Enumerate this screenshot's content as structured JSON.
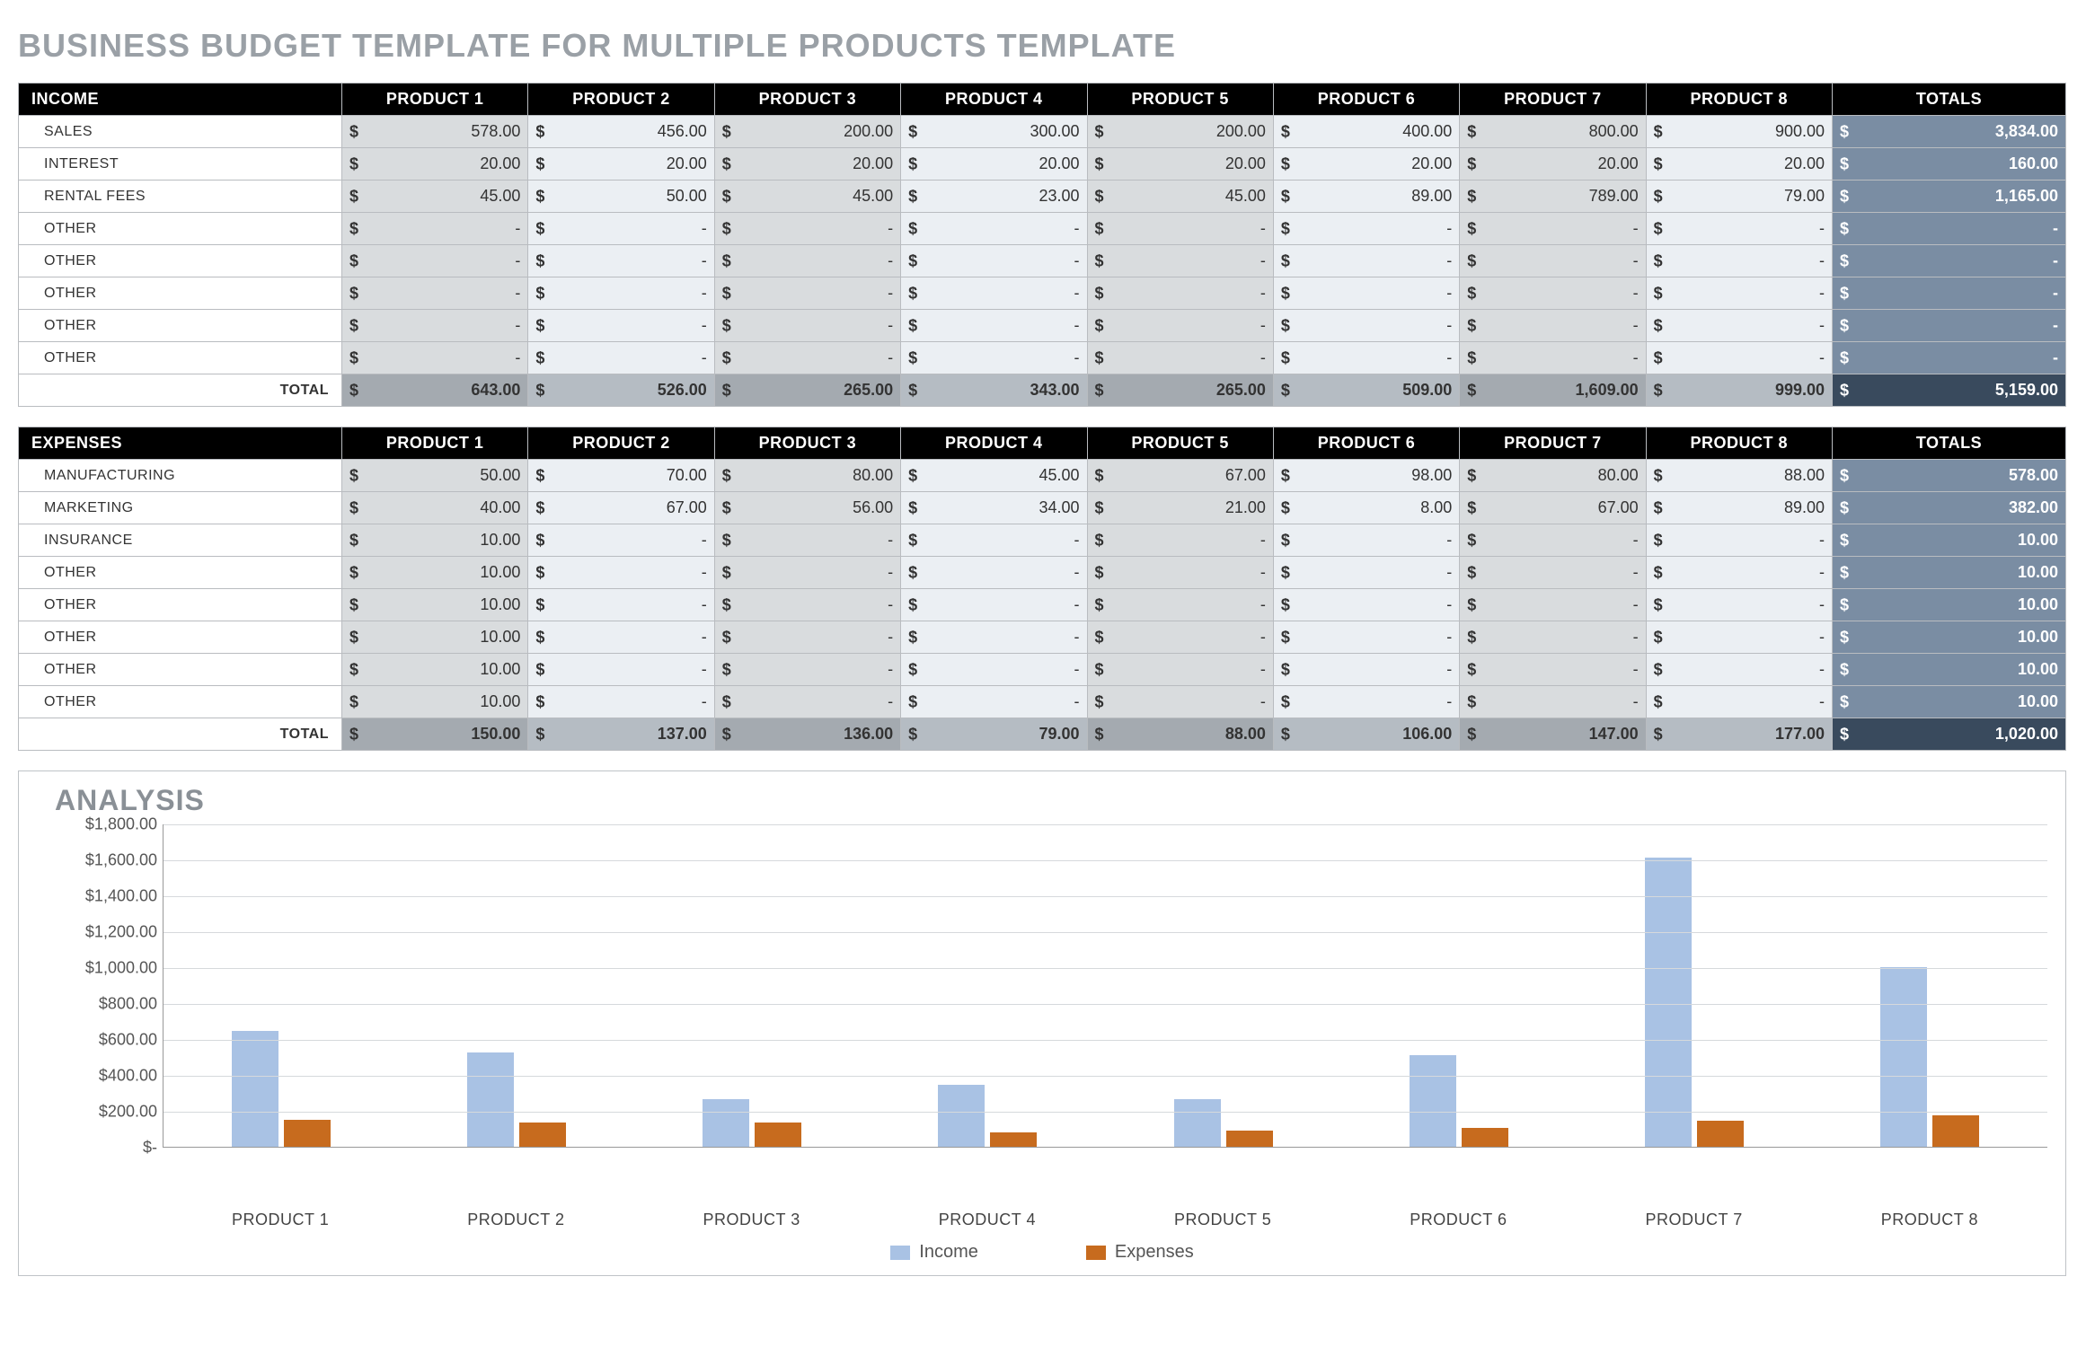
{
  "title": "BUSINESS BUDGET TEMPLATE FOR MULTIPLE PRODUCTS TEMPLATE",
  "currency_symbol": "$",
  "dash": "-",
  "products": [
    "PRODUCT 1",
    "PRODUCT 2",
    "PRODUCT 3",
    "PRODUCT 4",
    "PRODUCT 5",
    "PRODUCT 6",
    "PRODUCT 7",
    "PRODUCT 8"
  ],
  "totals_header": "TOTALS",
  "total_label": "TOTAL",
  "income": {
    "header": "INCOME",
    "rows": [
      {
        "label": "SALES",
        "values": [
          "578.00",
          "456.00",
          "200.00",
          "300.00",
          "200.00",
          "400.00",
          "800.00",
          "900.00"
        ],
        "total": "3,834.00"
      },
      {
        "label": "INTEREST",
        "values": [
          "20.00",
          "20.00",
          "20.00",
          "20.00",
          "20.00",
          "20.00",
          "20.00",
          "20.00"
        ],
        "total": "160.00"
      },
      {
        "label": "RENTAL FEES",
        "values": [
          "45.00",
          "50.00",
          "45.00",
          "23.00",
          "45.00",
          "89.00",
          "789.00",
          "79.00"
        ],
        "total": "1,165.00"
      },
      {
        "label": "OTHER",
        "values": [
          "-",
          "-",
          "-",
          "-",
          "-",
          "-",
          "-",
          "-"
        ],
        "total": "-"
      },
      {
        "label": "OTHER",
        "values": [
          "-",
          "-",
          "-",
          "-",
          "-",
          "-",
          "-",
          "-"
        ],
        "total": "-"
      },
      {
        "label": "OTHER",
        "values": [
          "-",
          "-",
          "-",
          "-",
          "-",
          "-",
          "-",
          "-"
        ],
        "total": "-"
      },
      {
        "label": "OTHER",
        "values": [
          "-",
          "-",
          "-",
          "-",
          "-",
          "-",
          "-",
          "-"
        ],
        "total": "-"
      },
      {
        "label": "OTHER",
        "values": [
          "-",
          "-",
          "-",
          "-",
          "-",
          "-",
          "-",
          "-"
        ],
        "total": "-"
      }
    ],
    "totals_row": {
      "values": [
        "643.00",
        "526.00",
        "265.00",
        "343.00",
        "265.00",
        "509.00",
        "1,609.00",
        "999.00"
      ],
      "total": "5,159.00"
    }
  },
  "expenses": {
    "header": "EXPENSES",
    "rows": [
      {
        "label": "MANUFACTURING",
        "values": [
          "50.00",
          "70.00",
          "80.00",
          "45.00",
          "67.00",
          "98.00",
          "80.00",
          "88.00"
        ],
        "total": "578.00"
      },
      {
        "label": "MARKETING",
        "values": [
          "40.00",
          "67.00",
          "56.00",
          "34.00",
          "21.00",
          "8.00",
          "67.00",
          "89.00"
        ],
        "total": "382.00"
      },
      {
        "label": "INSURANCE",
        "values": [
          "10.00",
          "-",
          "-",
          "-",
          "-",
          "-",
          "-",
          "-"
        ],
        "total": "10.00"
      },
      {
        "label": "OTHER",
        "values": [
          "10.00",
          "-",
          "-",
          "-",
          "-",
          "-",
          "-",
          "-"
        ],
        "total": "10.00"
      },
      {
        "label": "OTHER",
        "values": [
          "10.00",
          "-",
          "-",
          "-",
          "-",
          "-",
          "-",
          "-"
        ],
        "total": "10.00"
      },
      {
        "label": "OTHER",
        "values": [
          "10.00",
          "-",
          "-",
          "-",
          "-",
          "-",
          "-",
          "-"
        ],
        "total": "10.00"
      },
      {
        "label": "OTHER",
        "values": [
          "10.00",
          "-",
          "-",
          "-",
          "-",
          "-",
          "-",
          "-"
        ],
        "total": "10.00"
      },
      {
        "label": "OTHER",
        "values": [
          "10.00",
          "-",
          "-",
          "-",
          "-",
          "-",
          "-",
          "-"
        ],
        "total": "10.00"
      }
    ],
    "totals_row": {
      "values": [
        "150.00",
        "137.00",
        "136.00",
        "79.00",
        "88.00",
        "106.00",
        "147.00",
        "177.00"
      ],
      "total": "1,020.00"
    }
  },
  "chart": {
    "title": "ANALYSIS",
    "legend": {
      "income": "Income",
      "expenses": "Expenses"
    },
    "y_ticks": [
      "$1,800.00",
      "$1,600.00",
      "$1,400.00",
      "$1,200.00",
      "$1,000.00",
      "$800.00",
      "$600.00",
      "$400.00",
      "$200.00",
      "$-"
    ]
  },
  "chart_data": {
    "type": "bar",
    "title": "ANALYSIS",
    "xlabel": "",
    "ylabel": "",
    "ylim": [
      0,
      1800
    ],
    "categories": [
      "PRODUCT 1",
      "PRODUCT 2",
      "PRODUCT 3",
      "PRODUCT 4",
      "PRODUCT 5",
      "PRODUCT 6",
      "PRODUCT 7",
      "PRODUCT 8"
    ],
    "series": [
      {
        "name": "Income",
        "values": [
          643,
          526,
          265,
          343,
          265,
          509,
          1609,
          999
        ]
      },
      {
        "name": "Expenses",
        "values": [
          150,
          137,
          136,
          79,
          88,
          106,
          147,
          177
        ]
      }
    ]
  }
}
